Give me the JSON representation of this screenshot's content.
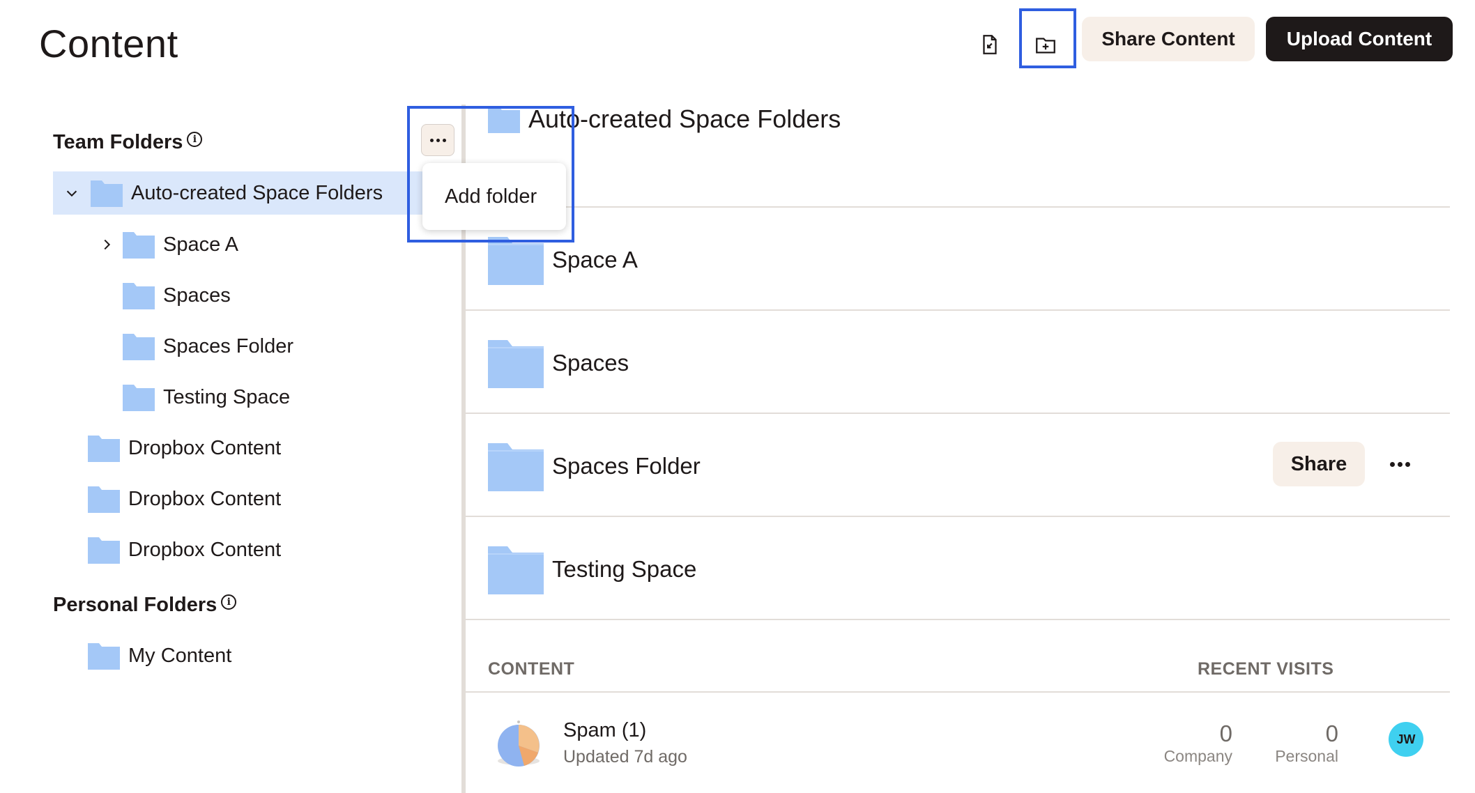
{
  "page": {
    "title": "Content"
  },
  "toolbar": {
    "share_label": "Share Content",
    "upload_label": "Upload Content",
    "icons": [
      "import-file-icon",
      "new-folder-icon"
    ]
  },
  "sidebar": {
    "team_heading": "Team Folders",
    "personal_heading": "Personal Folders",
    "info_glyph": "i",
    "team_items": [
      {
        "label": "Auto-created Space Folders",
        "expanded": true,
        "selected": true
      },
      {
        "label": "Space A",
        "collapsed": true
      },
      {
        "label": "Spaces"
      },
      {
        "label": "Spaces Folder"
      },
      {
        "label": "Testing Space"
      },
      {
        "label": "Dropbox Content"
      },
      {
        "label": "Dropbox Content"
      },
      {
        "label": "Dropbox Content"
      }
    ],
    "personal_items": [
      {
        "label": "My Content"
      }
    ],
    "menu": {
      "add_folder": "Add folder"
    }
  },
  "main": {
    "title": "Auto-created Space Folders",
    "folders": [
      {
        "label": "Space A"
      },
      {
        "label": "Spaces"
      },
      {
        "label": "Spaces Folder",
        "share_label": "Share"
      },
      {
        "label": "Testing Space"
      }
    ],
    "columns": {
      "content": "CONTENT",
      "recent_visits": "RECENT VISITS"
    },
    "content_items": [
      {
        "name": "Spam (1)",
        "updated": "Updated 7d ago",
        "company_visits": "0",
        "company_label": "Company",
        "personal_visits": "0",
        "personal_label": "Personal",
        "avatar": "JW"
      }
    ]
  },
  "colors": {
    "accent_highlight": "#2f5ee0",
    "folder_blue": "#a4c8f7",
    "selected_row": "#dae7fb",
    "button_light": "#f7efe8",
    "button_dark": "#1e1919",
    "avatar": "#3fd0f0"
  }
}
